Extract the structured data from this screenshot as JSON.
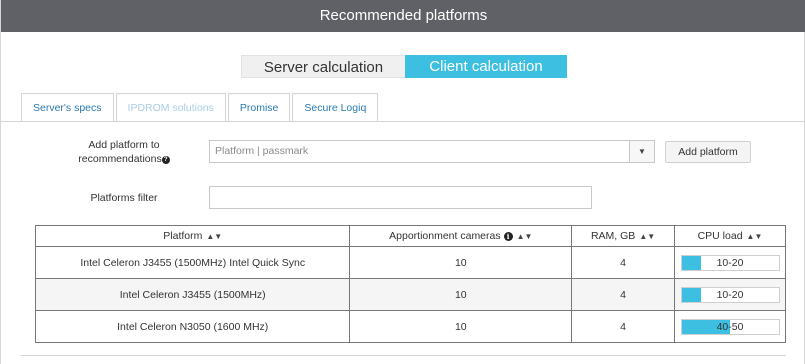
{
  "dialog": {
    "title": "Recommended platforms"
  },
  "mode_toggle": {
    "server_label": "Server calculation",
    "client_label": "Client calculation",
    "selected": "client"
  },
  "tabs": [
    {
      "label": "Server's specs",
      "active": true,
      "enabled": true
    },
    {
      "label": "IPDROM solutions",
      "active": false,
      "enabled": false
    },
    {
      "label": "Promise",
      "active": false,
      "enabled": true
    },
    {
      "label": "Secure Logiq",
      "active": false,
      "enabled": true
    }
  ],
  "add_platform": {
    "label_line1": "Add platform to",
    "label_line2": "recommendations",
    "placeholder": "Platform | passmark",
    "button_label": "Add platform"
  },
  "filter": {
    "label": "Platforms filter",
    "value": ""
  },
  "table": {
    "columns": [
      "Platform",
      "Apportionment cameras",
      "RAM, GB",
      "CPU load"
    ],
    "rows": [
      {
        "platform": "Intel Celeron J3455 (1500MHz) Intel Quick Sync",
        "cameras": "10",
        "ram": "4",
        "cpu_load": "10-20",
        "cpu_load_fill": 0.2
      },
      {
        "platform": "Intel Celeron J3455 (1500MHz)",
        "cameras": "10",
        "ram": "4",
        "cpu_load": "10-20",
        "cpu_load_fill": 0.2
      },
      {
        "platform": "Intel Celeron N3050 (1600 MHz)",
        "cameras": "10",
        "ram": "4",
        "cpu_load": "40-50",
        "cpu_load_fill": 0.5
      }
    ]
  },
  "icons": {
    "help": "question-circle-icon",
    "info": "info-circle-icon",
    "sort": "sort-arrows-icon",
    "dropdown": "caret-down-icon"
  },
  "colors": {
    "titlebar": "#5f6166",
    "accent": "#3cbfe0",
    "tab_text": "#2a7bb5"
  }
}
